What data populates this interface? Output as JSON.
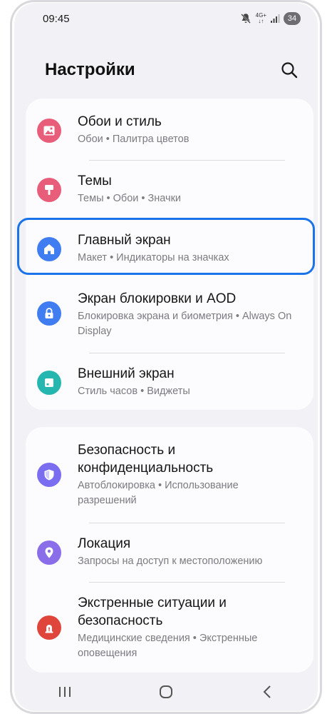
{
  "status": {
    "time": "09:45",
    "network_top": "4G+",
    "network_bottom": "↓↑",
    "battery": "34"
  },
  "header": {
    "title": "Настройки"
  },
  "colors": {
    "wallpaper": "#e85d7a",
    "themes": "#e85d7a",
    "home": "#3f7df0",
    "lock": "#3f7df0",
    "cover": "#26b6b0",
    "security": "#7b6df0",
    "location": "#8a6de8",
    "emergency": "#e0453c",
    "highlight": "#1a73e8"
  },
  "groups": [
    {
      "items": [
        {
          "icon": "image-icon",
          "label": "Обои и стиль",
          "sub": "Обои • Палитра цветов"
        },
        {
          "icon": "brush-icon",
          "label": "Темы",
          "sub": "Темы • Обои • Значки"
        },
        {
          "icon": "home-icon",
          "label": "Главный экран",
          "sub": "Макет • Индикаторы на значках"
        },
        {
          "icon": "lock-icon",
          "label": "Экран блокировки и AOD",
          "sub": "Блокировка экрана и биометрия • Always On Display"
        },
        {
          "icon": "cover-screen-icon",
          "label": "Внешний экран",
          "sub": "Стиль часов • Виджеты"
        }
      ]
    },
    {
      "items": [
        {
          "icon": "shield-icon",
          "label": "Безопасность и конфиденциальность",
          "sub": "Автоблокировка • Использование разрешений"
        },
        {
          "icon": "location-pin-icon",
          "label": "Локация",
          "sub": "Запросы на доступ к местоположению"
        },
        {
          "icon": "warning-icon",
          "label": "Экстренные ситуации и безопасность",
          "sub": "Медицинские сведения • Экстренные оповещения"
        }
      ]
    }
  ]
}
